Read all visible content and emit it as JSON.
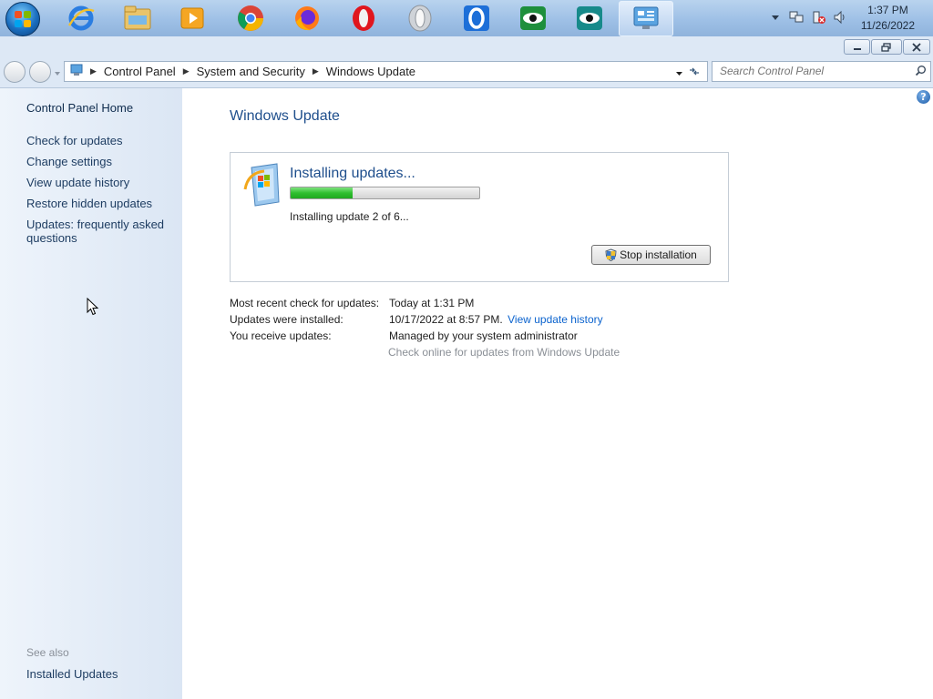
{
  "taskbar": {
    "apps": [
      {
        "name": "internet-explorer-icon"
      },
      {
        "name": "file-explorer-icon"
      },
      {
        "name": "media-player-icon"
      },
      {
        "name": "chrome-icon"
      },
      {
        "name": "firefox-icon"
      },
      {
        "name": "opera-icon"
      },
      {
        "name": "opera-gray-icon"
      },
      {
        "name": "opera-blue-icon"
      },
      {
        "name": "eye-app-icon"
      },
      {
        "name": "eye-app-teal-icon"
      },
      {
        "name": "control-panel-icon"
      }
    ],
    "clock": {
      "time": "1:37 PM",
      "date": "11/26/2022"
    }
  },
  "breadcrumb": {
    "items": [
      "Control Panel",
      "System and Security",
      "Windows Update"
    ]
  },
  "search": {
    "placeholder": "Search Control Panel"
  },
  "left_pane": {
    "home": "Control Panel Home",
    "links": [
      "Check for updates",
      "Change settings",
      "View update history",
      "Restore hidden updates",
      "Updates: frequently asked",
      "questions"
    ],
    "see_also": "See also",
    "installed_updates": "Installed Updates"
  },
  "main": {
    "title": "Windows Update",
    "status": {
      "title": "Installing updates...",
      "detail": "Installing update 2 of 6...",
      "progress": 0.33,
      "stop_button": "Stop installation"
    },
    "info": {
      "recent_check_label": "Most recent check for updates:",
      "recent_check_value": "Today at 1:31 PM",
      "installed_label": "Updates were installed:",
      "installed_value": "10/17/2022 at 8:57 PM.",
      "history_link": "View update history",
      "receive_label": "You receive updates:",
      "receive_value": "Managed by your system administrator",
      "online_check": "Check online for updates from Windows Update"
    }
  },
  "colors": {
    "accent_title": "#1e4e8c",
    "link": "#0b63ce",
    "progress": "#2fbf2f"
  }
}
